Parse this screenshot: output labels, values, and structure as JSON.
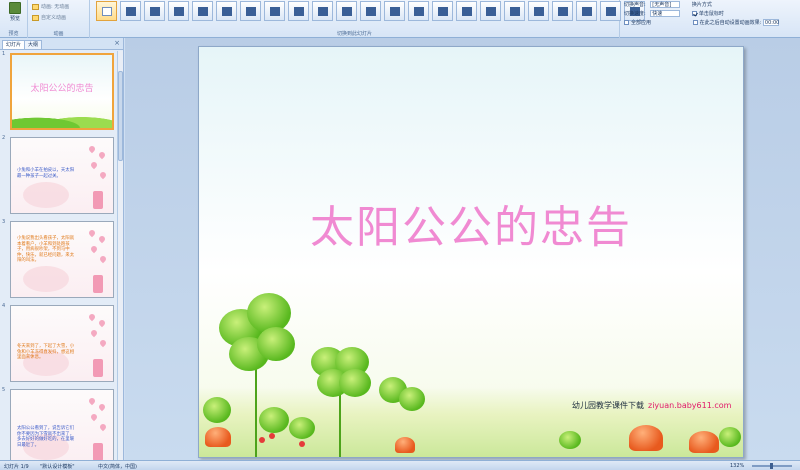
{
  "ribbon": {
    "preview_group": {
      "button_label": "预览",
      "group_label": "预览"
    },
    "animation_group": {
      "animate_label": "动画:",
      "animate_value": "无动画",
      "custom_animation_label": "自定义动画",
      "group_label": "动画"
    },
    "transitions": {
      "group_label": "切换到此幻灯片",
      "thumbs": [
        "none",
        "fade-smooth",
        "fade-black",
        "cut",
        "cut-black",
        "dissolve",
        "wipe-down",
        "wipe-left",
        "wipe-up",
        "wipe-right",
        "wipe-down-2",
        "blinds",
        "blinds-2",
        "box-in",
        "box-out",
        "checker",
        "cover-down",
        "cover-left",
        "cover-up",
        "cover-right",
        "strips",
        "uncover",
        "split"
      ]
    },
    "right_settings": {
      "sound_label": "切换声音:",
      "sound_value": "[无声音]",
      "speed_label": "切换速度:",
      "speed_value": "快速",
      "apply_all_label": "全部应用",
      "advance_label": "换片方式",
      "on_click_label": "单击鼠标时",
      "on_click_checked": true,
      "after_label": "在此之后自动设置动画效果:",
      "after_checked": false,
      "after_value": "00:00"
    }
  },
  "left_pane": {
    "tabs": {
      "slides": "幻灯片",
      "outline": "大纲"
    },
    "close": "×",
    "slides": [
      {
        "num": "1",
        "title": "太阳公公的忠告"
      },
      {
        "num": "2",
        "text": "小兔和小羊在拍皮以，天太阳最一种孩子一起过关。"
      },
      {
        "num": "3",
        "text": "小兔说我出头看孩子，太阳就本着看户，小羊和到处跑孩子，用病很吵架，不到马中仲，快乐，就已经问题，来太阳的叫法。"
      },
      {
        "num": "4",
        "text": "冬天来到了，下起了大雪，小兔和小羊冻得直发抖，想这相里面来休息。"
      },
      {
        "num": "5",
        "text": "太阳公公看到了，说告诉它们你不要因为下雪就不出来了，多去好好的做好吃的，在里暖日最近了。"
      }
    ]
  },
  "main_slide": {
    "title": "太阳公公的忠告",
    "credit_label": "幼儿园教学课件下载",
    "credit_url": "ziyuan.baby611.com"
  },
  "status_bar": {
    "slide_counter": "幻灯片 1/9",
    "theme": "\"默认设计模板\"",
    "language": "中文(简体，中国)",
    "zoom": "132%"
  },
  "colors": {
    "title_pink": "#f08ad2",
    "url_red": "#e0196a",
    "selection_orange": "#f0a43c",
    "ribbon_bg": "#d7e5f6"
  }
}
